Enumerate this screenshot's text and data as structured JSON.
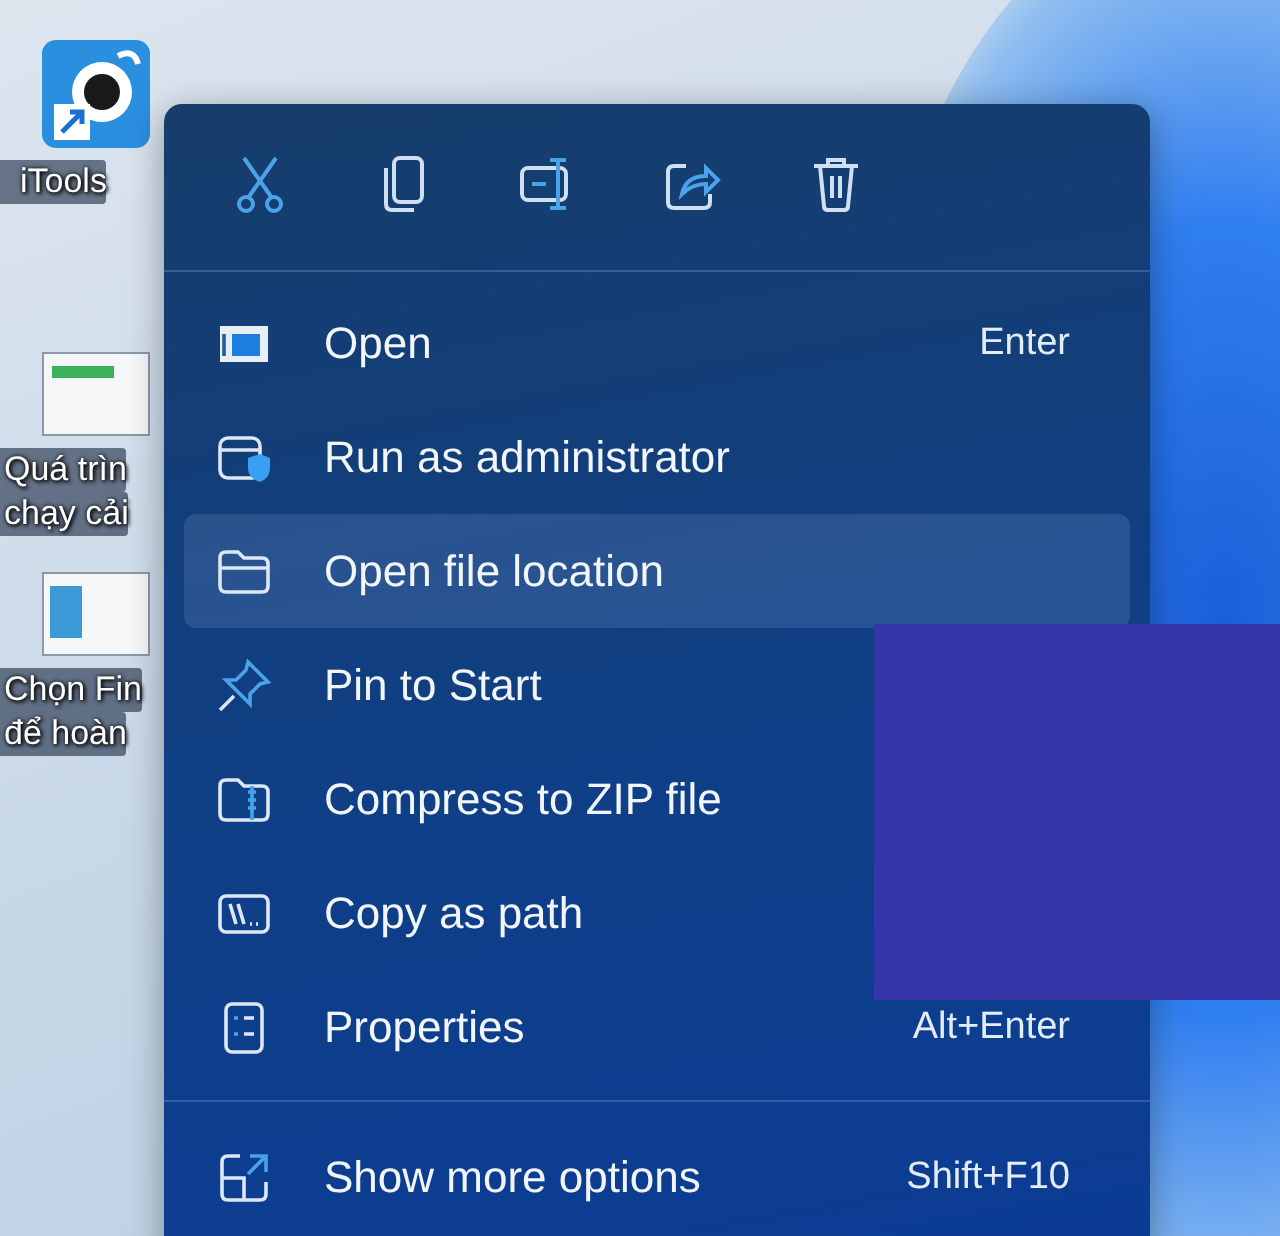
{
  "desktop_icons": [
    {
      "label_lines": [
        "iTools"
      ]
    },
    {
      "label_lines": [
        "Quá trìn",
        "chạy cải"
      ]
    },
    {
      "label_lines": [
        "Chọn Fin",
        "để hoàn"
      ]
    }
  ],
  "context_menu": {
    "items": [
      {
        "label": "Open",
        "shortcut": "Enter",
        "selected": false
      },
      {
        "label": "Run as administrator",
        "selected": false
      },
      {
        "label": "Open file location",
        "selected": true
      },
      {
        "label": "Pin to Start",
        "selected": false
      },
      {
        "label": "Compress to ZIP file",
        "selected": false
      },
      {
        "label": "Copy as path",
        "selected": false
      },
      {
        "label": "Properties",
        "shortcut": "Alt+Enter",
        "selected": false
      }
    ],
    "footer": {
      "label": "Show more options",
      "shortcut": "Shift+F10",
      "selected": false
    }
  }
}
